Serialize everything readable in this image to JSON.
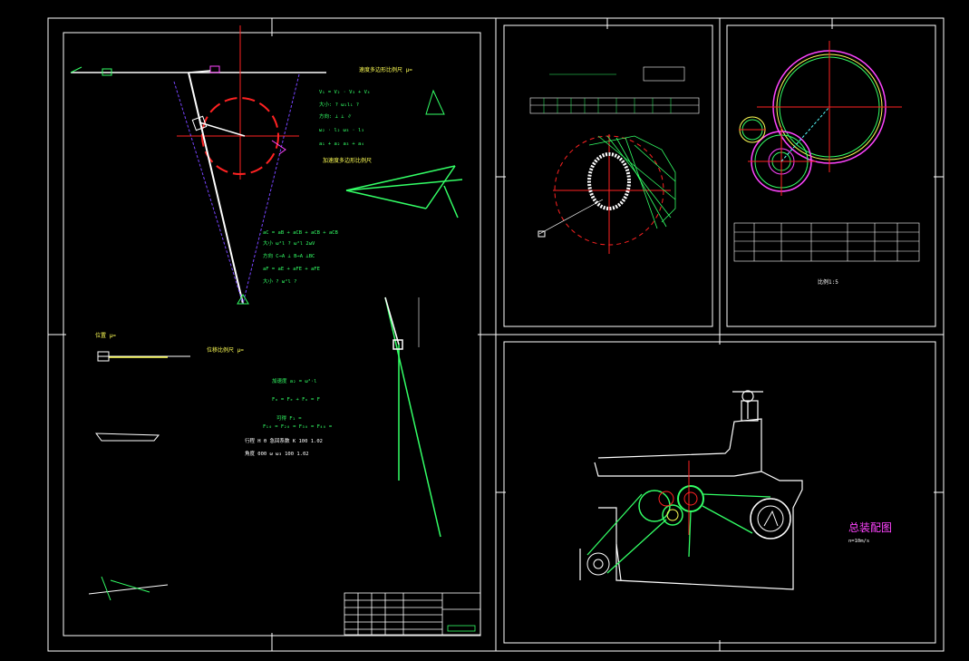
{
  "drawing": {
    "assembly_title": "总装配图",
    "assembly_scale": "n=10m/s",
    "gear_sheet_scale": "比例1:5",
    "colors": {
      "background": "#000000",
      "frame": "#ffffff",
      "mechanism": "#33ff66",
      "centerline": "#ff2222",
      "annotation": "#33ff66",
      "hatch": "#ff44ff",
      "dim": "#55ffff",
      "highlight": "#ffff55"
    }
  }
}
